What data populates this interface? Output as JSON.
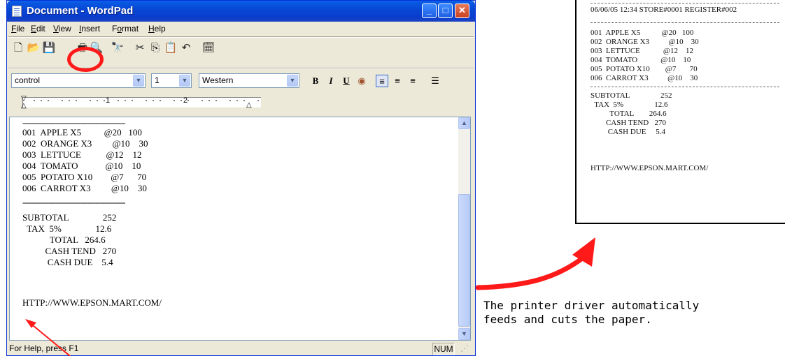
{
  "window": {
    "title": "Document - WordPad",
    "min_glyph": "_",
    "max_glyph": "□",
    "close_glyph": "✕"
  },
  "menu": [
    {
      "label": "File",
      "key": "F",
      "rest": "ile"
    },
    {
      "label": "Edit",
      "key": "E",
      "rest": "dit"
    },
    {
      "label": "View",
      "key": "V",
      "rest": "iew"
    },
    {
      "label": "Insert",
      "key": "I",
      "rest": "nsert"
    },
    {
      "label": "Format",
      "key": "o",
      "prefix": "F",
      "rest": "rmat"
    },
    {
      "label": "Help",
      "key": "H",
      "rest": "elp"
    }
  ],
  "toolbar_icons": {
    "new": "🗋",
    "open": "📂",
    "save": "💾",
    "print": "🖶",
    "preview": "🔍",
    "find": "🔭",
    "cut": "✂",
    "copy": "⎘",
    "paste": "📋",
    "undo": "↶",
    "datetime": "🗓"
  },
  "format": {
    "font": "control",
    "size": "1",
    "script": "Western",
    "bold": "B",
    "italic": "I",
    "underline": "U",
    "color": "◉",
    "align_left": "≡",
    "align_center": "≡",
    "align_right": "≡",
    "bullets": "☰"
  },
  "ruler": {
    "mark1": "1",
    "mark2": "2"
  },
  "document": {
    "dashes_top": "--------------------------------------------",
    "item1": "001  APPLE X5          @20   100",
    "item2": "002  ORANGE X3         @10    30",
    "item3": "003  LETTUCE           @12    12",
    "item4": "004  TOMATO            @10    10",
    "item5": "005  POTATO X10        @7      70",
    "item6": "006  CARROT X3         @10    30",
    "dashes_mid": "--------------------------------------------",
    "subtotal": "SUBTOTAL               252",
    "tax": "  TAX  5%               12.6",
    "total": "            TOTAL   264.6",
    "cash_tend": "          CASH TEND   270",
    "cash_due": "           CASH DUE    5.4",
    "url": "HTTP://WWW.EPSON.MART.COM/"
  },
  "status": {
    "help": "For Help, press F1",
    "num": "NUM"
  },
  "receipt": {
    "header": "06/06/05 12:34 STORE#0001 REGISTER#002",
    "item1": "001  APPLE X5           @20   100",
    "item2": "002  ORANGE X3          @10    30",
    "item3": "003  LETTUCE            @12    12",
    "item4": "004  TOMATO            @10    10",
    "item5": "005  POTATO X10        @7       70",
    "item6": "006  CARROT X3          @10    30",
    "subtotal": "SUBTOTAL                252",
    "tax": "  TAX  5%                12.6",
    "total": "          TOTAL        264.6",
    "cash_tend": "        CASH TEND   270",
    "cash_due": "         CASH DUE     5.4",
    "url": "HTTP://WWW.EPSON.MART.COM/"
  },
  "caption": "The printer driver automatically\nfeeds and cuts the paper.",
  "colors": {
    "accent": "#ff1a1a",
    "titlebar": "#0a5fe8"
  }
}
